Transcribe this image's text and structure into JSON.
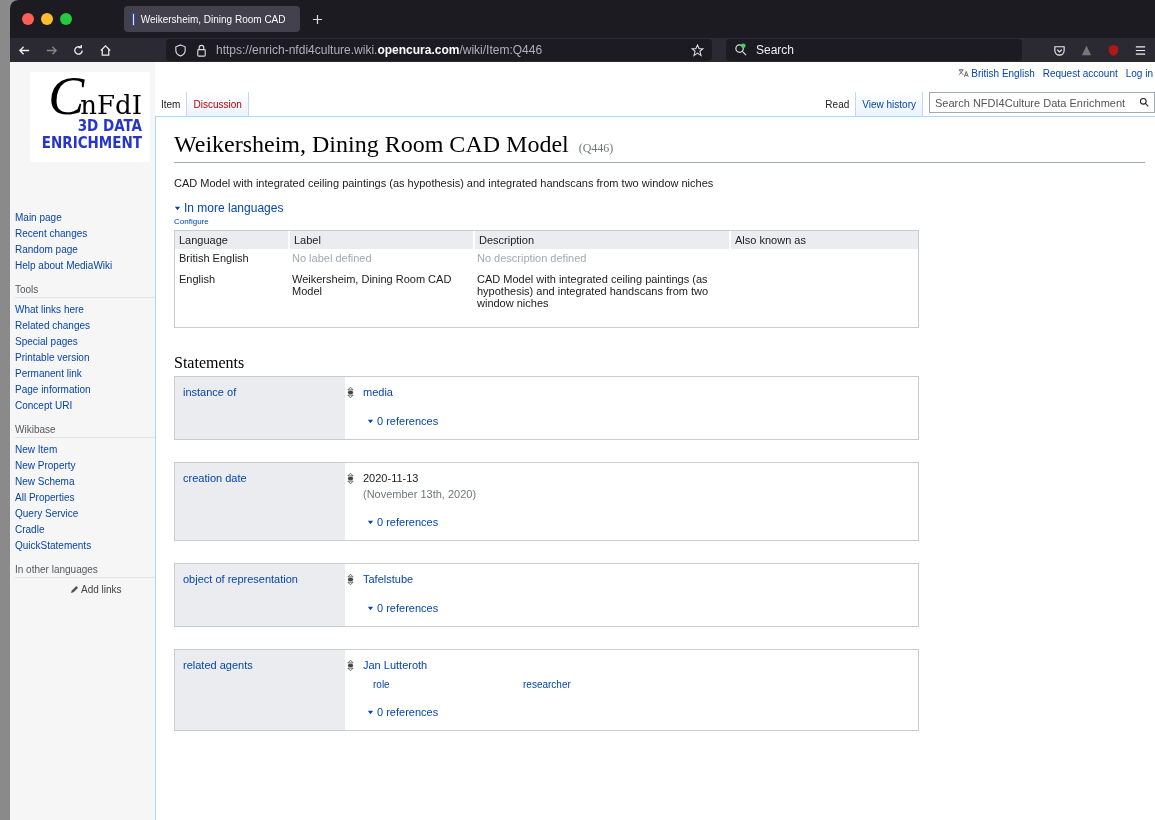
{
  "browser": {
    "tab_title": "Weikersheim, Dining Room CAD",
    "url_prefix": "https://enrich-nfdi4culture.wiki.",
    "url_domain": "opencura.com",
    "url_path": "/wiki/Item:Q446",
    "search_placeholder": "Search"
  },
  "personal_tools": [
    "British English",
    "Request account",
    "Log in"
  ],
  "logo": {
    "initial": "C",
    "name": "nFdI",
    "line1": "3D DATA",
    "line2": "ENRICHMENT"
  },
  "sidebar": {
    "navigation": [
      "Main page",
      "Recent changes",
      "Random page",
      "Help about MediaWiki"
    ],
    "sections": [
      {
        "heading": "Tools",
        "items": [
          "What links here",
          "Related changes",
          "Special pages",
          "Printable version",
          "Permanent link",
          "Page information",
          "Concept URI"
        ]
      },
      {
        "heading": "Wikibase",
        "items": [
          "New Item",
          "New Property",
          "New Schema",
          "All Properties",
          "Query Service",
          "Cradle",
          "QuickStatements"
        ]
      },
      {
        "heading": "In other languages"
      }
    ],
    "add_links": "Add links"
  },
  "left_tabs": [
    {
      "label": "Item",
      "selected": true
    },
    {
      "label": "Discussion",
      "selected": false
    }
  ],
  "right_tabs": [
    {
      "label": "Read",
      "selected": true
    },
    {
      "label": "View history",
      "selected": false
    }
  ],
  "wiki_search": {
    "placeholder": "Search NFDI4Culture Data Enrichment"
  },
  "title": "Weikersheim, Dining Room CAD Model",
  "item_id": "(Q446)",
  "description": "CAD Model with integrated ceiling paintings (as hypothesis) and integrated handscans from two window niches",
  "languages": {
    "toggle": "In more languages",
    "configure": "Configure",
    "columns": [
      "Language",
      "Label",
      "Description",
      "Also known as"
    ],
    "rows": [
      {
        "language": "British English",
        "label": "No label defined",
        "label_missing": true,
        "description": "No description defined",
        "description_missing": true
      },
      {
        "language": "English",
        "label": "Weikersheim, Dining Room CAD Model",
        "label_missing": false,
        "description": "CAD Model with integrated ceiling paintings (as hypothesis) and integrated handscans from two window niches",
        "description_missing": false
      }
    ]
  },
  "statements_heading": "Statements",
  "statements": [
    {
      "property": "instance of",
      "value": "media",
      "kind": "link",
      "references": "0 references"
    },
    {
      "property": "creation date",
      "value": "2020-11-13",
      "kind": "time",
      "detail": "(November 13th, 2020)",
      "references": "0 references"
    },
    {
      "property": "object of representation",
      "value": "Tafelstube",
      "kind": "link",
      "references": "0 references"
    },
    {
      "property": "related agents",
      "value": "Jan Lutteroth",
      "kind": "link",
      "qualifiers": [
        {
          "property": "role",
          "value": "researcher"
        }
      ],
      "references": "0 references"
    }
  ]
}
